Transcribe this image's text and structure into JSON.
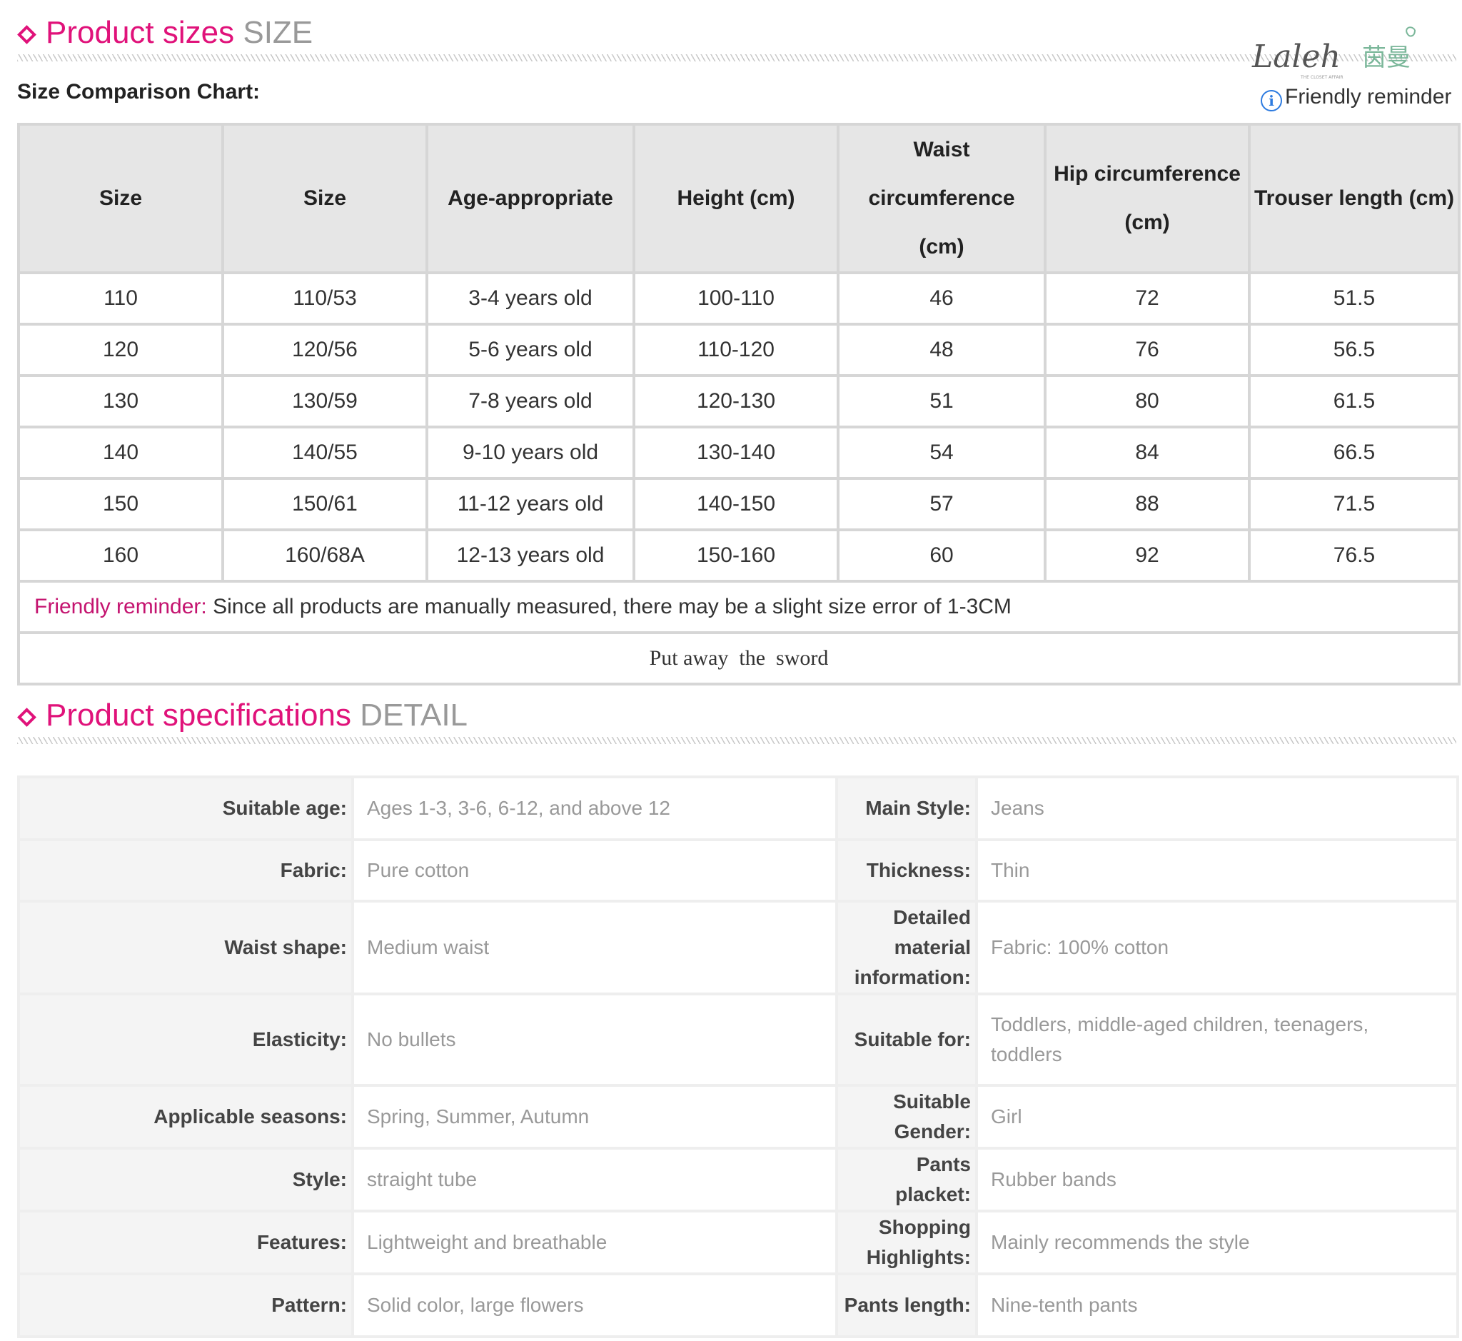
{
  "sections": {
    "size": {
      "title_zh": "Product sizes",
      "title_en": "SIZE"
    },
    "detail": {
      "title_zh": "Product specifications",
      "title_en": "DETAIL"
    }
  },
  "logo": {
    "script_text": "Laleh",
    "cn_text": "茵曼",
    "tagline": "THE CLOSET AFFAIR"
  },
  "chart_label": "Size Comparison Chart:",
  "friendly_reminder_link": "Friendly reminder",
  "size_table": {
    "headers": [
      "Size",
      "Size",
      "Age-appropriate",
      "Height (cm)",
      "Waist circumference (cm)",
      "Hip circumference (cm)",
      "Trouser length (cm)"
    ],
    "rows": [
      [
        "110",
        "110/53",
        "3-4 years old",
        "100-110",
        "46",
        "72",
        "51.5"
      ],
      [
        "120",
        "120/56",
        "5-6 years old",
        "110-120",
        "48",
        "76",
        "56.5"
      ],
      [
        "130",
        "130/59",
        "7-8 years old",
        "120-130",
        "51",
        "80",
        "61.5"
      ],
      [
        "140",
        "140/55",
        "9-10 years old",
        "130-140",
        "54",
        "84",
        "66.5"
      ],
      [
        "150",
        "150/61",
        "11-12 years old",
        "140-150",
        "57",
        "88",
        "71.5"
      ],
      [
        "160",
        "160/68A",
        "12-13 years old",
        "150-160",
        "60",
        "92",
        "76.5"
      ]
    ],
    "reminder_label": "Friendly reminder:",
    "reminder_text": " Since all products are manually measured, there may be a slight size error of 1-3CM",
    "footer": "Put away  the  sword"
  },
  "specs": [
    {
      "label": "Suitable age:",
      "value": "Ages 1-3, 3-6, 6-12, and above 12",
      "label2": "Main Style:",
      "value2": "Jeans"
    },
    {
      "label": "Fabric:",
      "value": "Pure cotton",
      "label2": "Thickness:",
      "value2": "Thin"
    },
    {
      "label": "Waist shape:",
      "value": "Medium waist",
      "label2": "Detailed material information:",
      "value2": "Fabric: 100% cotton"
    },
    {
      "label": "Elasticity:",
      "value": "No bullets",
      "label2": "Suitable for:",
      "value2": "Toddlers, middle-aged children, teenagers, toddlers"
    },
    {
      "label": "Applicable seasons:",
      "value": "Spring, Summer, Autumn",
      "label2": "Suitable Gender:",
      "value2": "Girl"
    },
    {
      "label": "Style:",
      "value": "straight tube",
      "label2": "Pants placket:",
      "value2": "Rubber bands"
    },
    {
      "label": "Features:",
      "value": "Lightweight and breathable",
      "label2": "Shopping Highlights:",
      "value2": "Mainly recommends the style"
    },
    {
      "label": "Pattern:",
      "value": "Solid color, large flowers",
      "label2": "Pants length:",
      "value2": "Nine-tenth pants"
    }
  ],
  "colors": {
    "accent": "#e0127a",
    "reminder": "#c4136f",
    "info_blue": "#2d7be0",
    "border": "#d6d6d6",
    "header_bg": "#e6e6e6"
  }
}
